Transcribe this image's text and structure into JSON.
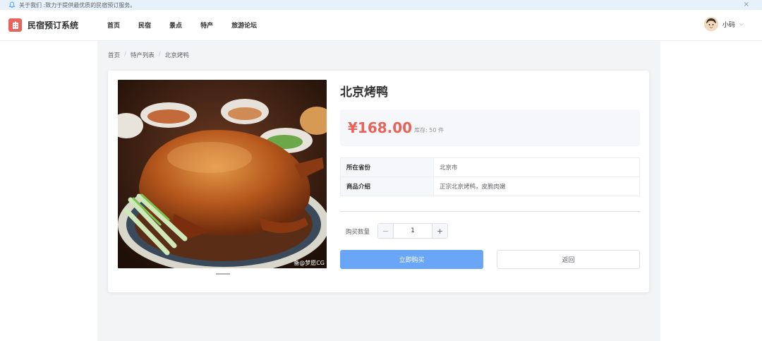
{
  "notice": {
    "text": "关于我们 :致力于提供最优质的民宿预订服务。",
    "close": "×"
  },
  "header": {
    "brand": "民宿预订系统",
    "menu": [
      "首页",
      "民宿",
      "景点",
      "特产",
      "旅游论坛"
    ],
    "user": {
      "name": "小码",
      "chevron": "⌵"
    }
  },
  "breadcrumb": [
    "首页",
    "特产列表",
    "北京烤鸭"
  ],
  "product": {
    "title": "北京烤鸭",
    "price": "¥168.00",
    "stock": "库存: 50 件",
    "image_watermark": "备@梦愿CG",
    "specs": [
      {
        "key": "所在省份",
        "value": "北京市"
      },
      {
        "key": "商品介绍",
        "value": "正宗北京烤鸭，皮脆肉嫩"
      }
    ],
    "quantity_label": "购买数量",
    "quantity": "1",
    "minus": "−",
    "plus": "+",
    "buy_label": "立即购买",
    "back_label": "返回"
  },
  "colors": {
    "accent": "#6aa6f8",
    "price": "#e8635a",
    "notice_bg": "#e6f1fc"
  }
}
